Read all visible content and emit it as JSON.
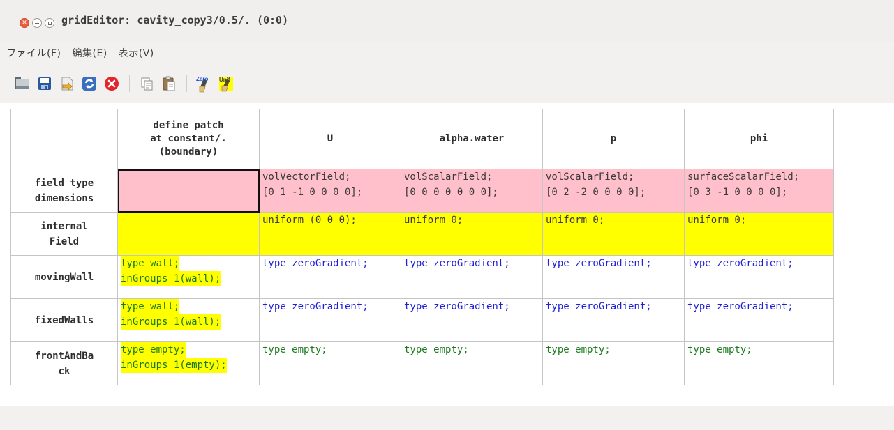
{
  "window": {
    "title": "gridEditor: cavity_copy3/0.5/. (0:0)"
  },
  "menubar": {
    "items": [
      {
        "label": "ファイル(F)"
      },
      {
        "label": "編集(E)"
      },
      {
        "label": "表示(V)"
      }
    ]
  },
  "toolbar": {
    "buttons": [
      {
        "icon": "open-folder-icon"
      },
      {
        "icon": "save-icon"
      },
      {
        "icon": "save-as-icon"
      },
      {
        "icon": "reload-icon"
      },
      {
        "icon": "close-icon"
      },
      {
        "icon": "copy-icon"
      },
      {
        "icon": "paste-icon"
      },
      {
        "icon": "zero-brush-icon",
        "badge": "Zero"
      },
      {
        "icon": "unif-brush-icon",
        "badge": "Unif"
      }
    ]
  },
  "grid": {
    "columns": [
      {
        "label": "",
        "lines": []
      },
      {
        "label": "define patch at constant/. (boundary)",
        "lines": [
          "define patch",
          "at constant/.",
          "(boundary)"
        ]
      },
      {
        "label": "U",
        "lines": [
          "U"
        ]
      },
      {
        "label": "alpha.water",
        "lines": [
          "alpha.water"
        ]
      },
      {
        "label": "p",
        "lines": [
          "p"
        ]
      },
      {
        "label": "phi",
        "lines": [
          "phi"
        ]
      }
    ],
    "rows": [
      {
        "header_lines": [
          "field type",
          "dimensions"
        ],
        "cells": [
          {
            "lines": [],
            "bg": "pink",
            "color": "normal",
            "selected": true
          },
          {
            "lines": [
              "volVectorField;",
              "[0 1 -1 0 0 0 0];"
            ],
            "bg": "pink",
            "color": "normal"
          },
          {
            "lines": [
              "volScalarField;",
              "[0 0 0 0 0 0 0];"
            ],
            "bg": "pink",
            "color": "normal"
          },
          {
            "lines": [
              "volScalarField;",
              "[0 2 -2 0 0 0 0];"
            ],
            "bg": "pink",
            "color": "normal"
          },
          {
            "lines": [
              "surfaceScalarField;",
              "[0 3 -1 0 0 0 0];"
            ],
            "bg": "pink",
            "color": "normal"
          }
        ]
      },
      {
        "header_lines": [
          "internal",
          "Field"
        ],
        "cells": [
          {
            "lines": [],
            "bg": "yellow",
            "color": "normal"
          },
          {
            "lines": [
              "uniform (0 0 0);"
            ],
            "bg": "yellow",
            "color": "normal"
          },
          {
            "lines": [
              "uniform 0;"
            ],
            "bg": "yellow",
            "color": "normal"
          },
          {
            "lines": [
              "uniform 0;"
            ],
            "bg": "yellow",
            "color": "normal"
          },
          {
            "lines": [
              "uniform 0;"
            ],
            "bg": "yellow",
            "color": "normal"
          }
        ]
      },
      {
        "header_lines": [
          "movingWall"
        ],
        "cells": [
          {
            "lines": [
              "type wall;",
              "inGroups 1(wall);"
            ],
            "bg": "yellow-text",
            "color": "green"
          },
          {
            "lines": [
              "type zeroGradient;"
            ],
            "bg": "white",
            "color": "blue"
          },
          {
            "lines": [
              "type zeroGradient;"
            ],
            "bg": "white",
            "color": "blue"
          },
          {
            "lines": [
              "type zeroGradient;"
            ],
            "bg": "white",
            "color": "blue"
          },
          {
            "lines": [
              "type zeroGradient;"
            ],
            "bg": "white",
            "color": "blue"
          }
        ]
      },
      {
        "header_lines": [
          "fixedWalls"
        ],
        "cells": [
          {
            "lines": [
              "type wall;",
              "inGroups 1(wall);"
            ],
            "bg": "yellow-text",
            "color": "green"
          },
          {
            "lines": [
              "type zeroGradient;"
            ],
            "bg": "white",
            "color": "blue"
          },
          {
            "lines": [
              "type zeroGradient;"
            ],
            "bg": "white",
            "color": "blue"
          },
          {
            "lines": [
              "type zeroGradient;"
            ],
            "bg": "white",
            "color": "blue"
          },
          {
            "lines": [
              "type zeroGradient;"
            ],
            "bg": "white",
            "color": "blue"
          }
        ]
      },
      {
        "header_lines": [
          "frontAndBa",
          "ck"
        ],
        "cells": [
          {
            "lines": [
              "type empty;",
              "inGroups 1(empty);"
            ],
            "bg": "yellow-text",
            "color": "green"
          },
          {
            "lines": [
              "type empty;"
            ],
            "bg": "white",
            "color": "green"
          },
          {
            "lines": [
              "type empty;"
            ],
            "bg": "white",
            "color": "green"
          },
          {
            "lines": [
              "type empty;"
            ],
            "bg": "white",
            "color": "green"
          },
          {
            "lines": [
              "type empty;"
            ],
            "bg": "white",
            "color": "green"
          }
        ]
      }
    ]
  },
  "colors": {
    "pink": "#ffc0cb",
    "yellow": "#ffff00",
    "blue_text": "#1f1fd8",
    "green_text": "#1b7a1b"
  }
}
